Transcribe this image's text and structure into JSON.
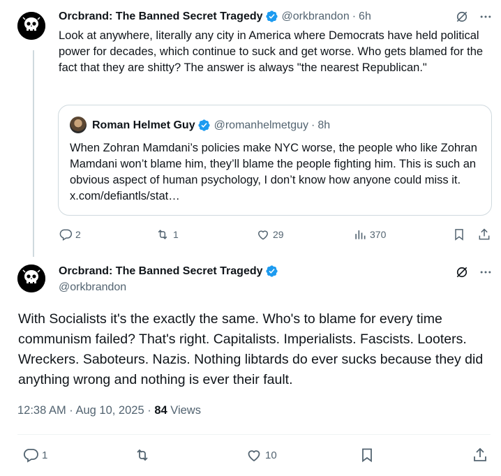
{
  "colors": {
    "text": "#0f1419",
    "secondary": "#536471",
    "verified_blue": "#1d9bf0",
    "border": "#cfd9de"
  },
  "parent_post": {
    "display_name": "Orcbrand: The Banned Secret Tragedy",
    "handle": "@orkbrandon",
    "separator": "·",
    "time": "6h",
    "text": "Look at anywhere, literally any city in America where Democrats have held political power for decades, which continue to suck and get worse. Who gets blamed for the fact that they are shitty? The answer is always \"the nearest Republican.\"",
    "quote": {
      "display_name": "Roman Helmet Guy",
      "handle": "@romanhelmetguy",
      "separator": "·",
      "time": "8h",
      "text": "When Zohran Mamdani’s policies make NYC worse, the people who like Zohran Mamdani won’t blame him, they’ll blame the people fighting him. This is such an obvious aspect of human psychology, I don’t know how anyone could miss it. x.com/defiantls/stat…"
    },
    "stats": {
      "replies": "2",
      "reposts": "1",
      "likes": "29",
      "views": "370"
    }
  },
  "main_post": {
    "display_name": "Orcbrand: The Banned Secret Tragedy",
    "handle": "@orkbrandon",
    "text": "With Socialists it's the exactly the same. Who's to blame for every time communism failed? That's right. Capitalists. Imperialists. Fascists. Looters. Wreckers. Saboteurs. Nazis. Nothing libtards do ever sucks because they did anything wrong and nothing is ever their fault.",
    "timestamp": "12:38 AM · Aug 10, 2025 · ",
    "views_count": "84",
    "views_label": " Views",
    "stats": {
      "replies": "1",
      "likes": "10"
    }
  },
  "icons": [
    "skull-avatar-icon",
    "verified-icon",
    "grok-icon",
    "more-icon",
    "reply-icon",
    "repost-icon",
    "like-icon",
    "views-icon",
    "bookmark-icon",
    "share-icon"
  ]
}
